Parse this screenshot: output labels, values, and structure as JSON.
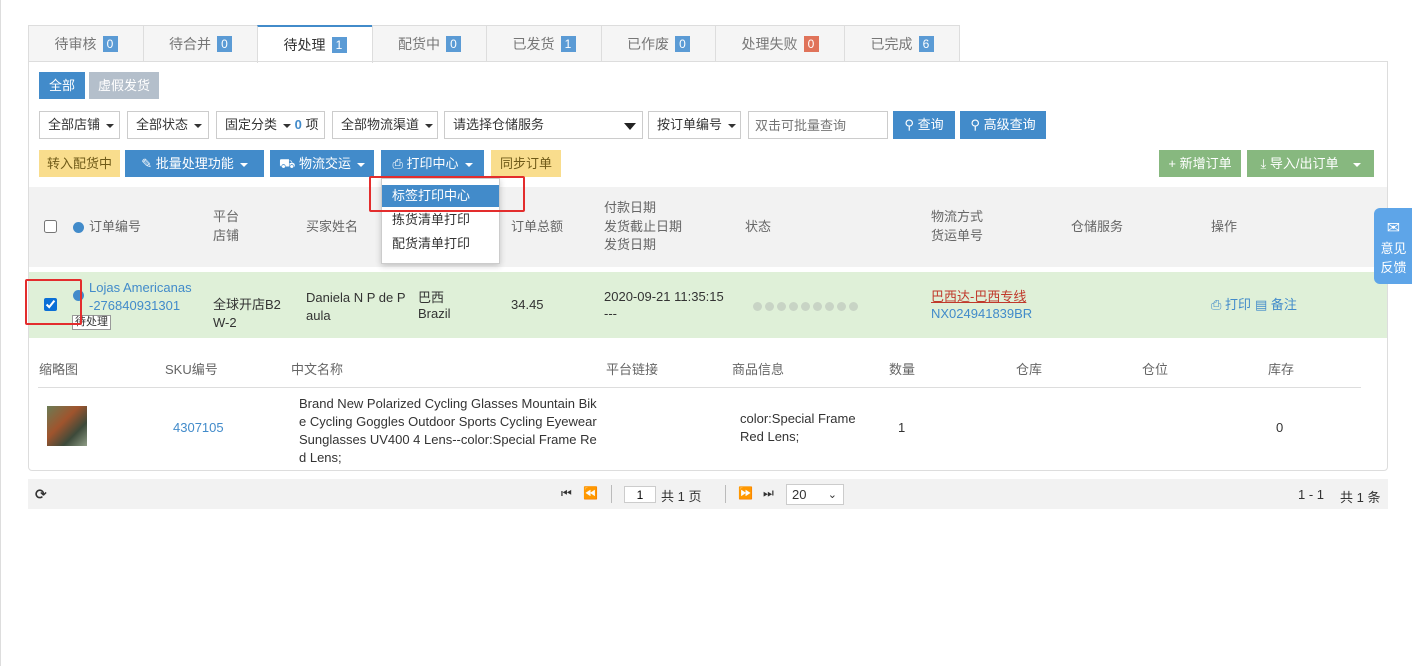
{
  "tabs": [
    {
      "label": "待审核",
      "count": "0",
      "active": false,
      "red": false,
      "width": 116
    },
    {
      "label": "待合并",
      "count": "0",
      "active": false,
      "red": false,
      "width": 115
    },
    {
      "label": "待处理",
      "count": "1",
      "active": true,
      "red": false,
      "width": 116
    },
    {
      "label": "配货中",
      "count": "0",
      "active": false,
      "red": false,
      "width": 115
    },
    {
      "label": "已发货",
      "count": "1",
      "active": false,
      "red": false,
      "width": 116
    },
    {
      "label": "已作废",
      "count": "0",
      "active": false,
      "red": false,
      "width": 115
    },
    {
      "label": "处理失败",
      "count": "0",
      "active": false,
      "red": true,
      "width": 130
    },
    {
      "label": "已完成",
      "count": "6",
      "active": false,
      "red": false,
      "width": 116
    }
  ],
  "filters": {
    "all_btn": "全部",
    "virtual_btn": "虚假发货",
    "store": "全部店铺",
    "status": "全部状态",
    "category": "固定分类",
    "category_count": "0",
    "category_unit": "项",
    "logistics": "全部物流渠道",
    "warehouse": "请选择仓储服务",
    "order_no": "按订单编号",
    "search_placeholder": "双击可批量查询",
    "query_btn": "查询",
    "adv_query_btn": "高级查询"
  },
  "actions": {
    "to_picking": "转入配货中",
    "batch": "批量处理功能",
    "logistics_ship": "物流交运",
    "print_center": "打印中心",
    "sync": "同步订单",
    "new_order": "新增订单",
    "import_export": "导入/出订单"
  },
  "print_menu": [
    "标签打印中心",
    "拣货清单打印",
    "配货清单打印"
  ],
  "table_head": {
    "order_no": "订单编号",
    "platform": "平台",
    "store": "店铺",
    "buyer": "买家姓名",
    "total": "订单总额",
    "pay_date": "付款日期",
    "ship_deadline": "发货截止日期",
    "ship_date": "发货日期",
    "status": "状态",
    "ship_method": "物流方式",
    "tracking": "货运单号",
    "warehouse": "仓储服务",
    "ops": "操作"
  },
  "order": {
    "platform": "Lojas Americanas",
    "order_id": "-276840931301",
    "tooltip": "待处理",
    "store": "全球开店B2W-2",
    "buyer": "Daniela N P de Paula",
    "country_cn": "巴西",
    "country_en": "Brazil",
    "total": "34.45",
    "pay_date": "2020-09-21 11:35:15",
    "ship_dash": "---",
    "ship_method": "巴西达-巴西专线",
    "tracking": "NX024941839BR",
    "print": "打印",
    "note": "备注"
  },
  "sub_head": [
    "缩略图",
    "SKU编号",
    "中文名称",
    "平台链接",
    "商品信息",
    "数量",
    "仓库",
    "仓位",
    "库存"
  ],
  "item": {
    "sku": "4307105",
    "name": "Brand New Polarized Cycling Glasses Mountain Bike Cycling Goggles Outdoor Sports Cycling Eyewear Sunglasses UV400 4 Lens--color:Special Frame Red Lens;",
    "info": "color:Special Frame Red Lens;",
    "qty": "1",
    "stock": "0"
  },
  "pager": {
    "page": "1",
    "total_pages": "共 1 页",
    "page_size": "20",
    "range": "1 - 1",
    "total": "共 1 条"
  },
  "feedback": [
    "意见",
    "反馈"
  ],
  "colors": {
    "primary": "#428bca",
    "row_selected": "#dff0d8",
    "highlight_box": "#e32d2d"
  }
}
